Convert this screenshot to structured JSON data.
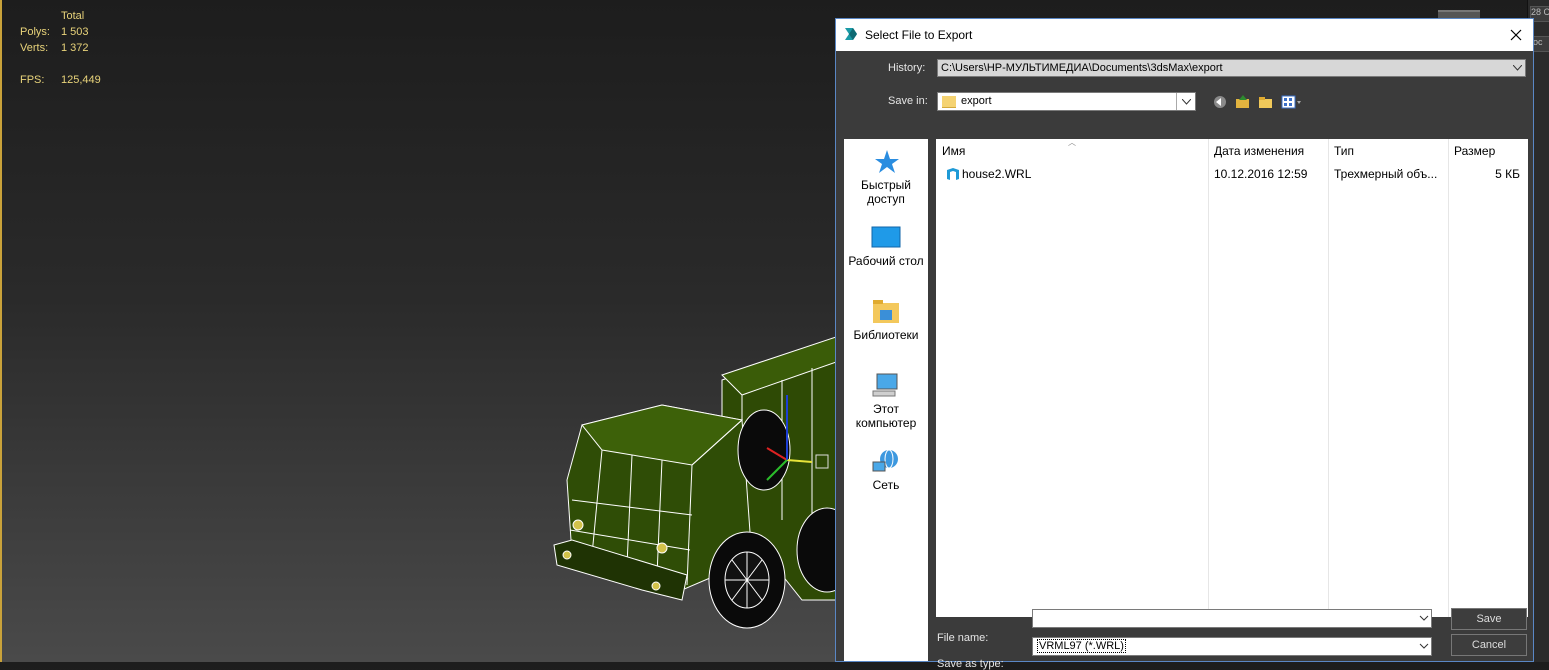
{
  "viewport": {
    "stats": {
      "header": "Total",
      "polys_label": "Polys:",
      "polys_value": "1 503",
      "verts_label": "Verts:",
      "verts_value": "1 372",
      "fps_label": "FPS:",
      "fps_value": "125,449"
    }
  },
  "right_strip": {
    "tab1": "28 C",
    "tab2": "loc"
  },
  "dialog": {
    "title": "Select File to Export",
    "history_label": "History:",
    "history_value": "C:\\Users\\HP-МУЛЬТИМЕДИА\\Documents\\3dsMax\\export",
    "save_in_label": "Save in:",
    "save_in_value": "export",
    "places": [
      {
        "label": "Быстрый доступ",
        "icon": "star-icon"
      },
      {
        "label": "Рабочий стол",
        "icon": "desktop-icon"
      },
      {
        "label": "Библиотеки",
        "icon": "libraries-icon"
      },
      {
        "label": "Этот компьютер",
        "icon": "computer-icon"
      },
      {
        "label": "Сеть",
        "icon": "network-icon"
      }
    ],
    "columns": {
      "name": "Имя",
      "date": "Дата изменения",
      "type": "Тип",
      "size": "Размер"
    },
    "files": [
      {
        "name": "house2.WRL",
        "date": "10.12.2016 12:59",
        "type": "Трехмерный объ...",
        "size": "5 КБ"
      }
    ],
    "file_name_label": "File name:",
    "file_name_value": "",
    "save_as_type_label": "Save as type:",
    "save_as_type_value": "VRML97 (*.WRL)",
    "save_button": "Save",
    "cancel_button": "Cancel"
  }
}
